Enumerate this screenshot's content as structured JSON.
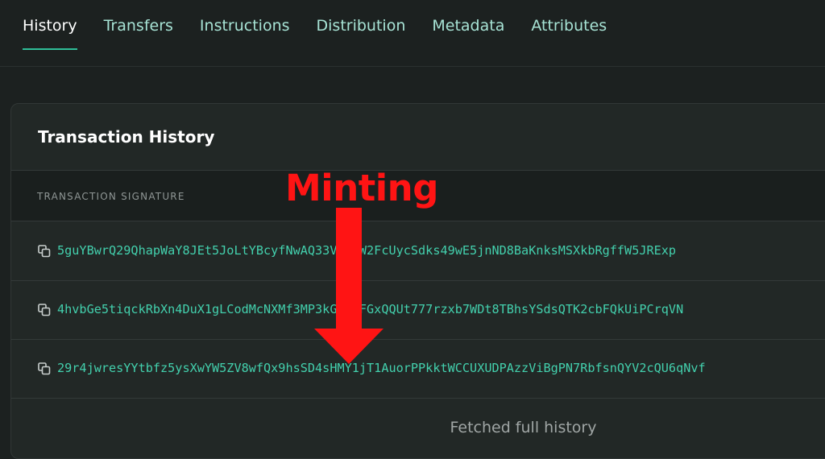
{
  "tabs": [
    {
      "label": "History",
      "active": true
    },
    {
      "label": "Transfers",
      "active": false
    },
    {
      "label": "Instructions",
      "active": false
    },
    {
      "label": "Distribution",
      "active": false
    },
    {
      "label": "Metadata",
      "active": false
    },
    {
      "label": "Attributes",
      "active": false
    }
  ],
  "card": {
    "title": "Transaction History",
    "column_header": "TRANSACTION SIGNATURE",
    "rows": [
      {
        "signature": "5guYBwrQ29QhapWaY8JEt5JoLtYBcyfNwAQ33Vb7zW2FcUycSdks49wE5jnND8BaKnksMSXkbRgffW5JRExp"
      },
      {
        "signature": "4hvbGe5tiqckRbXn4DuX1gLCodMcNXMf3MP3kGrAPFGxQQUt777rzxb7WDt8TBhsYSdsQTK2cbFQkUiPCrqVN"
      },
      {
        "signature": "29r4jwresYYtbfz5ysXwYW5ZV8wfQx9hsSD4sHMY1jT1AuorPPkktWCCUXUDPAzzViBgPN7RbfsnQYV2cQU6qNvf"
      }
    ],
    "footer_note": "Fetched full history"
  },
  "annotation": {
    "label": "Minting",
    "color": "#ff1414"
  },
  "colors": {
    "accent": "#2fbf98",
    "signature": "#43d0ad",
    "background": "#1c2120"
  },
  "icons": {
    "copy": "copy-icon"
  }
}
